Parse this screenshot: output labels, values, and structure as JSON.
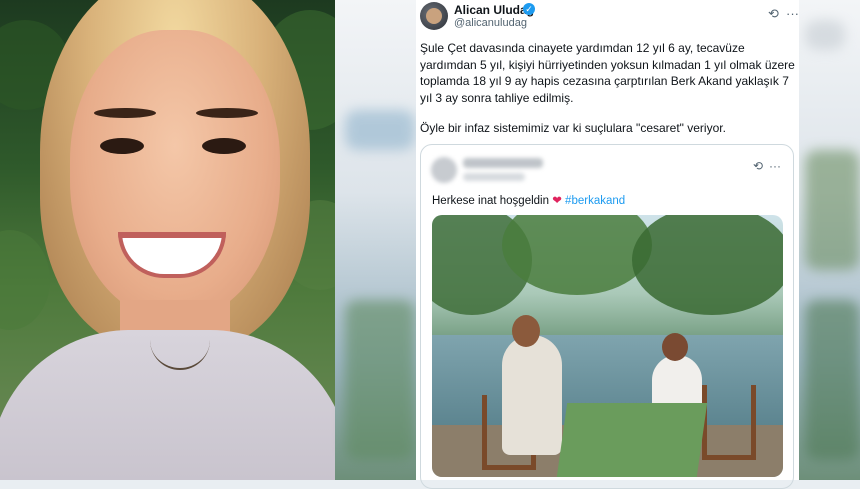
{
  "tweet": {
    "display_name": "Alican Uludağ",
    "handle": "@alicanuludag",
    "verified_mark": "✓",
    "paragraphs": [
      "Şule Çet davasında cinayete yardımdan 12 yıl 6 ay, tecavüze yardımdan 5 yıl, kişiyi hürriyetinden yoksun kılmadan 1 yıl olmak üzere toplamda 18 yıl 9 ay hapis cezasına çarptırılan Berk Akand yaklaşık 7 yıl 3 ay sonra tahliye edilmiş.",
      "Öyle bir infaz sistemimiz var ki suçlulara \"cesaret\" veriyor."
    ],
    "icons": [
      "grok-icon",
      "more-icon"
    ]
  },
  "quote": {
    "text_prefix": "Herkese inat hoşgeldin",
    "heart": "❤",
    "hashtag": "#berkakand",
    "icons": [
      "grok-icon",
      "more-icon"
    ]
  },
  "glyphs": {
    "grok": "⟲",
    "more": "···"
  }
}
